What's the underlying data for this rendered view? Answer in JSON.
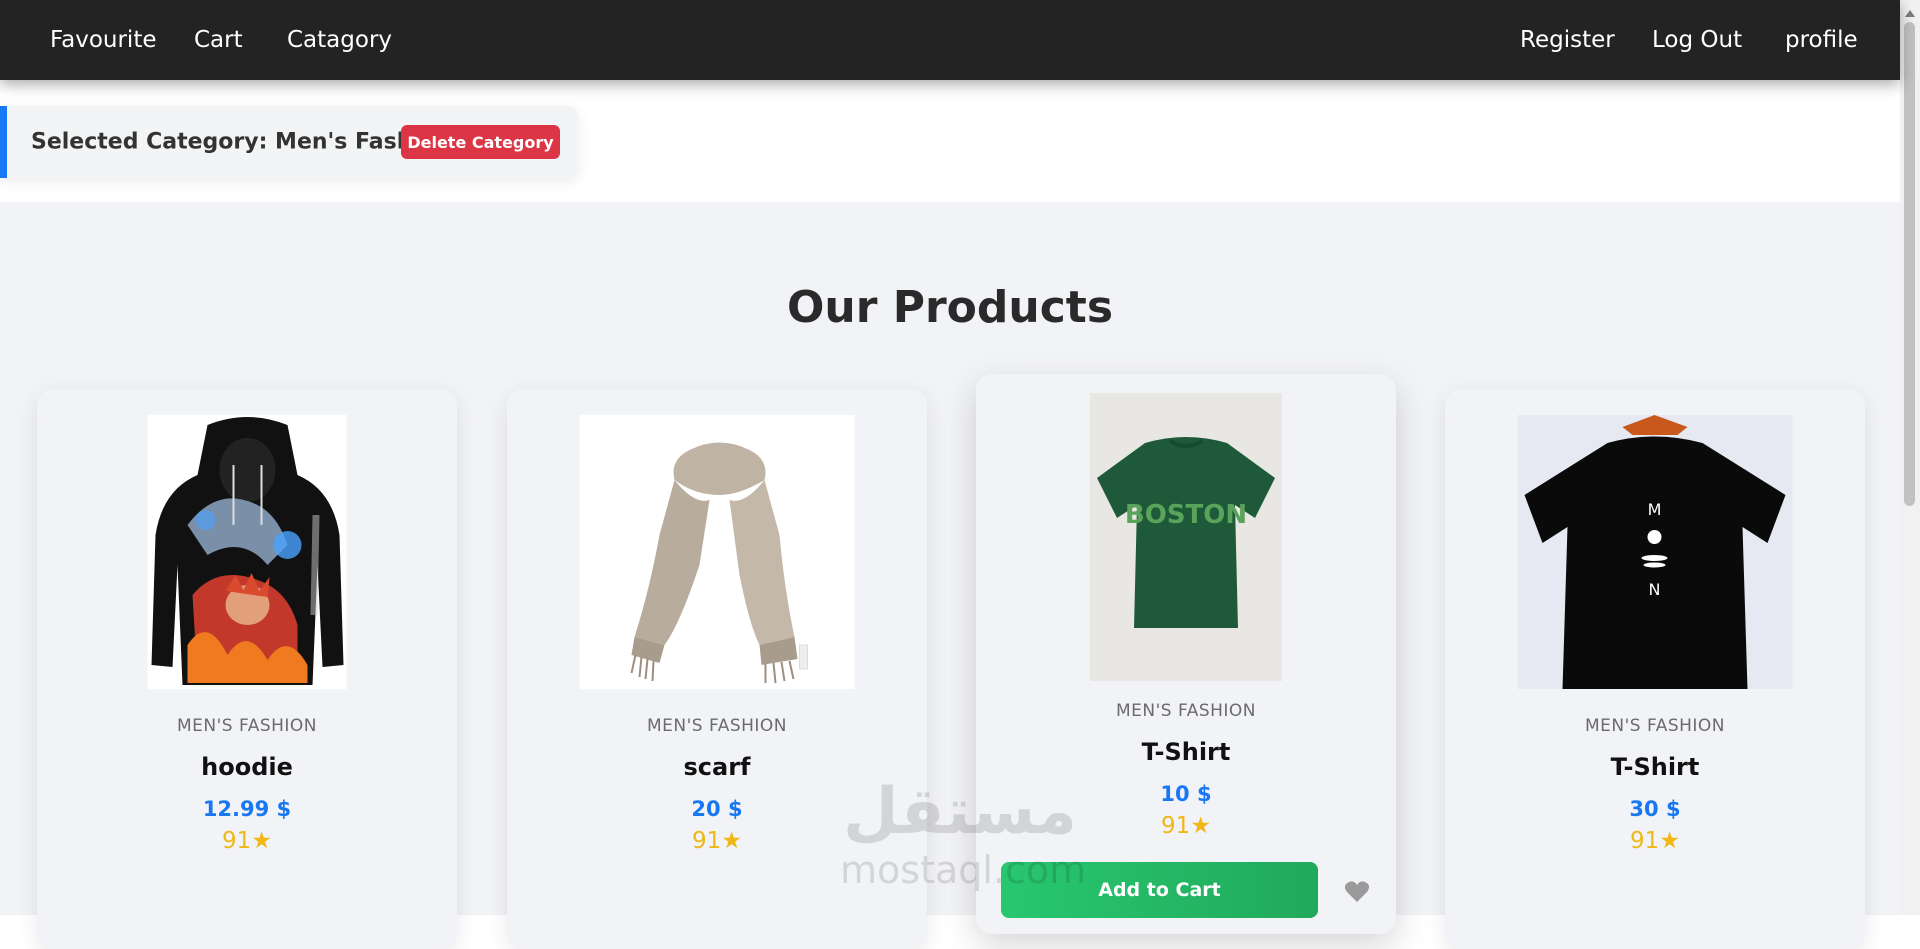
{
  "navbar": {
    "left_links": [
      "Favourite",
      "Cart",
      "Catagory"
    ],
    "right_links": [
      "Register",
      "Log Out",
      "profile"
    ]
  },
  "category_banner": {
    "text": "Selected Category: Men's Fashion",
    "delete_label": "Delete Category",
    "accent_color": "#1877f2"
  },
  "products_section": {
    "title": "Our Products",
    "products": [
      {
        "category": "MEN'S FASHION",
        "name": "hoodie",
        "price": "12.99 $",
        "rating": "91★",
        "image": "hoodie-image"
      },
      {
        "category": "MEN'S FASHION",
        "name": "scarf",
        "price": "20 $",
        "rating": "91★",
        "image": "scarf-image"
      },
      {
        "category": "MEN'S FASHION",
        "name": "T-Shirt",
        "price": "10 $",
        "rating": "91★",
        "image": "green-tshirt-image",
        "add_to_cart_label": "Add to Cart",
        "favourite_icon": "heart-icon"
      },
      {
        "category": "MEN'S FASHION",
        "name": "T-Shirt",
        "price": "30 $",
        "rating": "91★",
        "image": "black-tshirt-image"
      }
    ]
  },
  "watermark": {
    "arabic": "مستقل",
    "latin": "mostaql.com"
  },
  "colors": {
    "price": "#1877f2",
    "rating": "#f0b719",
    "delete": "#dc3545",
    "add_to_cart": "#28c76f"
  }
}
